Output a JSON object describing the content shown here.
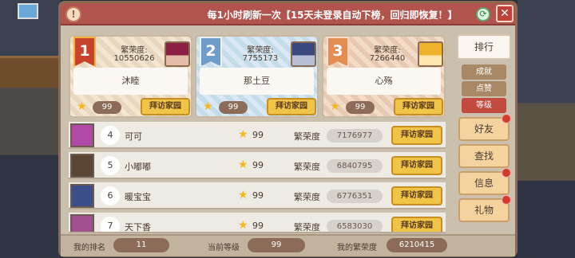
{
  "header": {
    "title": "每1小时刷新一次【15天未登录自动下榜，回归即恢复！】",
    "info_glyph": "!",
    "refresh_glyph": "⟳",
    "close_glyph": "✕"
  },
  "podium": [
    {
      "rank": "1",
      "label": "繁荣度:",
      "value": "10550626",
      "name": "沐睦",
      "level": "99",
      "visit": "拜访家园"
    },
    {
      "rank": "2",
      "label": "繁荣度:",
      "value": "7755173",
      "name": "那土豆",
      "level": "99",
      "visit": "拜访家园"
    },
    {
      "rank": "3",
      "label": "繁荣度:",
      "value": "7266440",
      "name": "心殇",
      "level": "99",
      "visit": "拜访家园"
    }
  ],
  "rows": [
    {
      "rank": "4",
      "name": "可可",
      "level": "99",
      "label": "繁荣度",
      "value": "7176977",
      "visit": "拜访家园",
      "avatar_color": "#b14aa6"
    },
    {
      "rank": "5",
      "name": "小嘟嘟",
      "level": "99",
      "label": "繁荣度",
      "value": "6840795",
      "visit": "拜访家园",
      "avatar_color": "#5b4636"
    },
    {
      "rank": "6",
      "name": "暖宝宝",
      "level": "99",
      "label": "繁荣度",
      "value": "6776351",
      "visit": "拜访家园",
      "avatar_color": "#3d4f8a"
    },
    {
      "rank": "7",
      "name": "天下香",
      "level": "99",
      "label": "繁荣度",
      "value": "6583030",
      "visit": "拜访家园",
      "avatar_color": "#a0508e"
    }
  ],
  "side": {
    "main_tab": "排行",
    "subtabs": [
      {
        "label": "成就",
        "color": "#a88865"
      },
      {
        "label": "点赞",
        "color": "#a88865"
      },
      {
        "label": "等级",
        "color": "#c24a3f"
      }
    ],
    "tabs": [
      "好友",
      "查找",
      "信息",
      "礼物"
    ]
  },
  "footer": {
    "rank_label": "我的排名",
    "rank_value": "11",
    "level_label": "当前等级",
    "level_value": "99",
    "prosperity_label": "我的繁荣度",
    "prosperity_value": "6210415"
  },
  "icons": {
    "star": "★"
  }
}
